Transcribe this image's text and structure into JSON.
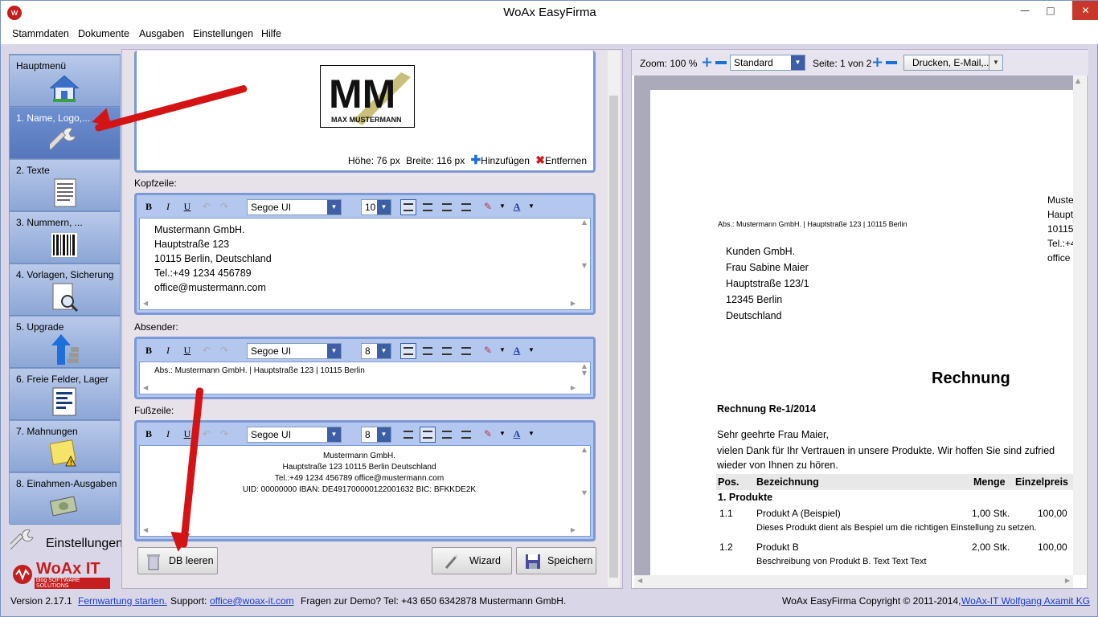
{
  "window": {
    "title": "WoAx EasyFirma",
    "app_icon": "woax-logo-icon"
  },
  "menu": [
    "Stammdaten",
    "Dokumente",
    "Ausgaben",
    "Einstellungen",
    "Hilfe"
  ],
  "sidebar": {
    "items": [
      {
        "label": "Hauptmenü",
        "icon": "house-icon"
      },
      {
        "label": "1. Name, Logo,...",
        "icon": "wrench-icon",
        "active": true
      },
      {
        "label": "2. Texte",
        "icon": "document-text-icon"
      },
      {
        "label": "3. Nummern, ...",
        "icon": "barcode-icon"
      },
      {
        "label": "4. Vorlagen, Sicherung",
        "icon": "magnifier-document-icon"
      },
      {
        "label": "5. Upgrade",
        "icon": "upgrade-arrow-icon"
      },
      {
        "label": "6. Freie Felder, Lager",
        "icon": "form-fields-icon"
      },
      {
        "label": "7. Mahnungen",
        "icon": "warning-note-icon"
      },
      {
        "label": "8. Einahmen-Ausgaben",
        "icon": "money-icon"
      }
    ],
    "settings_label": "Einstellungen",
    "brand": "WoAx IT",
    "brand_sub": "blog SOFTWARE SOLUTIONS"
  },
  "logo_panel": {
    "logo_text": "MM",
    "logo_sub": "MAX MUSTERMANN",
    "height_label": "Höhe: 76 px",
    "width_label": "Breite: 116 px",
    "add_label": "Hinzufügen",
    "remove_label": "Entfernen"
  },
  "editors": {
    "kopfzeile": {
      "label": "Kopfzeile:",
      "font": "Segoe UI",
      "size": "10",
      "lines": [
        "Mustermann GmbH.",
        "Hauptstraße 123",
        "10115 Berlin, Deutschland",
        "Tel.:+49 1234 456789",
        "office@mustermann.com"
      ]
    },
    "absender": {
      "label": "Absender:",
      "font": "Segoe UI",
      "size": "8",
      "lines": [
        "Abs.: Mustermann GmbH. | Hauptstraße 123 | 10115 Berlin"
      ]
    },
    "fusszeile": {
      "label": "Fußzeile:",
      "font": "Segoe UI",
      "size": "8",
      "lines": [
        "Mustermann GmbH.",
        "Hauptstraße 123 10115 Berlin Deutschland",
        "Tel.:+49 1234 456789 office@mustermann.com",
        "UID: 00000000 IBAN: DE49170000012200163​2 BIC: BFKKDE2K"
      ]
    }
  },
  "buttons": {
    "db_clear": "DB leeren",
    "wizard": "Wizard",
    "save": "Speichern"
  },
  "preview_toolbar": {
    "zoom": "Zoom: 100 %",
    "view": "Standard",
    "page": "Seite: 1 von 2",
    "print": "Drucken, E-Mail,..."
  },
  "document": {
    "sender_line": "Abs.: Mustermann GmbH. | Hauptstraße 123 | 10115 Berlin",
    "header_cut": [
      "Muste",
      "Haupt",
      "10115",
      "Tel.:+4",
      "office"
    ],
    "recipient": [
      "Kunden GmbH.",
      "Frau Sabine Maier",
      "Hauptstraße 123/1",
      "12345 Berlin",
      "Deutschland"
    ],
    "title": "Rechnung",
    "number": "Rechnung Re-1/2014",
    "greeting": "Sehr geehrte Frau Maier,",
    "intro1": "vielen Dank für Ihr Vertrauen in unsere Produkte. Wir hoffen Sie sind zufried",
    "intro2": "wieder von Ihnen zu hören.",
    "col_pos": "Pos.",
    "col_desc": "Bezeichnung",
    "col_qty": "Menge",
    "col_price": "Einzelpreis",
    "group": "1. Produkte",
    "rows": [
      {
        "pos": "1.1",
        "name": "Produkt A (Beispiel)",
        "qty": "1,00 Stk.",
        "price": "100,00",
        "desc": "Dieses Produkt dient als Bespiel um die richtigen Einstellung zu setzen."
      },
      {
        "pos": "1.2",
        "name": "Produkt B",
        "qty": "2,00 Stk.",
        "price": "100,00",
        "desc": "Beschreibung von Produkt B. Text Text Text"
      }
    ]
  },
  "status": {
    "version": "Version 2.17.1",
    "remote": "Fernwartung starten.",
    "support_label": "Support:",
    "support_mail": "office@woax-it.com",
    "demo": "Fragen zur Demo? Tel: +43 650 6342878 Mustermann GmbH.",
    "copyright": "WoAx EasyFirma Copyright © 2011-2014,",
    "company": "WoAx-IT Wolfgang Axamit KG"
  }
}
